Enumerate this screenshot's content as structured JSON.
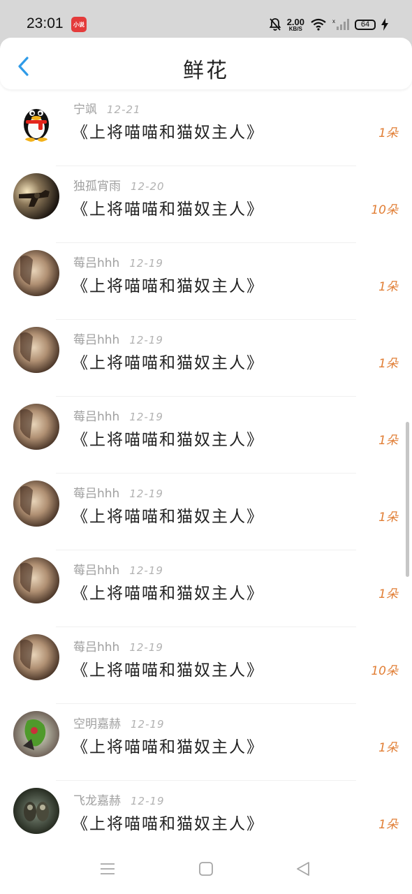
{
  "status_bar": {
    "time": "23:01",
    "app_badge": "小说",
    "net_speed_value": "2.00",
    "net_speed_unit": "KB/S",
    "battery": "64",
    "icons": [
      "bell-muted-icon",
      "wifi-icon",
      "cell-signal-icon",
      "charging-bolt-icon"
    ]
  },
  "header": {
    "title": "鲜花",
    "back_icon": "chevron-left-icon"
  },
  "gifts": [
    {
      "user": "宁飒",
      "date": "12-21",
      "book": "《上将喵喵和猫奴主人》",
      "amount": "1朵",
      "avatar": "qq-penguin"
    },
    {
      "user": "独孤宵雨",
      "date": "12-20",
      "book": "《上将喵喵和猫奴主人》",
      "amount": "10朵",
      "avatar": "revolver"
    },
    {
      "user": "莓吕hhh",
      "date": "12-19",
      "book": "《上将喵喵和猫奴主人》",
      "amount": "1朵",
      "avatar": "photo-girl"
    },
    {
      "user": "莓吕hhh",
      "date": "12-19",
      "book": "《上将喵喵和猫奴主人》",
      "amount": "1朵",
      "avatar": "photo-girl"
    },
    {
      "user": "莓吕hhh",
      "date": "12-19",
      "book": "《上将喵喵和猫奴主人》",
      "amount": "1朵",
      "avatar": "photo-girl"
    },
    {
      "user": "莓吕hhh",
      "date": "12-19",
      "book": "《上将喵喵和猫奴主人》",
      "amount": "1朵",
      "avatar": "photo-girl"
    },
    {
      "user": "莓吕hhh",
      "date": "12-19",
      "book": "《上将喵喵和猫奴主人》",
      "amount": "1朵",
      "avatar": "photo-girl"
    },
    {
      "user": "莓吕hhh",
      "date": "12-19",
      "book": "《上将喵喵和猫奴主人》",
      "amount": "10朵",
      "avatar": "photo-girl"
    },
    {
      "user": "空明嘉赫",
      "date": "12-19",
      "book": "《上将喵喵和猫奴主人》",
      "amount": "1朵",
      "avatar": "green-figure"
    },
    {
      "user": "飞龙嘉赫",
      "date": "12-19",
      "book": "《上将喵喵和猫奴主人》",
      "amount": "1朵",
      "avatar": "dark-photo"
    }
  ],
  "nav_bar": {
    "icons": [
      "menu-icon",
      "home-square-icon",
      "back-triangle-icon"
    ]
  },
  "colors": {
    "accent_blue": "#2f9be8",
    "amount_orange": "#e17e35",
    "status_bar_bg": "#d7d7d7"
  }
}
